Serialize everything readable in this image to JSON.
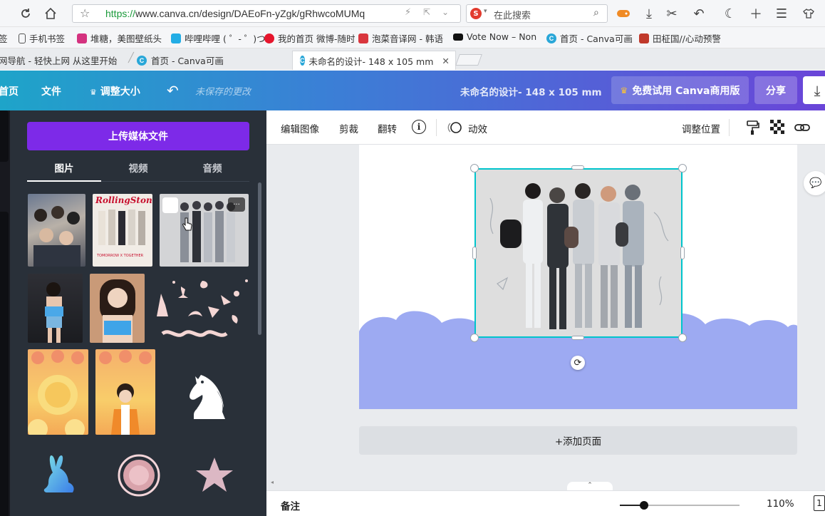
{
  "browser": {
    "url_scheme": "https://",
    "url_rest": "www.canva.cn/design/DAEoFn-yZgk/gRhwcoMUMq",
    "search_placeholder": "在此搜索",
    "search_engine_icon": "S"
  },
  "bookmarks": [
    {
      "label": "签"
    },
    {
      "label": "手机书签"
    },
    {
      "label": "堆糖，美图壁纸头"
    },
    {
      "label": "哔哩哔哩 ( ゜- ゜)つ"
    },
    {
      "label": "我的首页 微博-随时"
    },
    {
      "label": "泡菜音译网 - 韩语"
    },
    {
      "label": "Vote Now – Non"
    },
    {
      "label": "首页 - Canva可画"
    },
    {
      "label": "田柾国//心动预警"
    }
  ],
  "tabs": [
    {
      "label": "网导航 - 轻快上网 从这里开始"
    },
    {
      "label": "首页 - Canva可画"
    },
    {
      "label": "未命名的设计- 148 x 105 mm"
    }
  ],
  "header": {
    "home": "首页",
    "file": "文件",
    "resize": "调整大小",
    "unsaved": "未保存的更改",
    "title": "未命名的设计- 148 x 105 mm",
    "trial": "免费试用 Canva商用版",
    "share": "分享"
  },
  "panel": {
    "upload": "上传媒体文件",
    "tabs": [
      "图片",
      "视频",
      "音频"
    ],
    "thumb_text": {
      "magazine": "RollingStone",
      "magazine_sub": "TOMORROW X TOGETHER",
      "more": "···"
    }
  },
  "toolbar": {
    "edit_image": "编辑图像",
    "crop": "剪裁",
    "flip": "翻转",
    "info": "i",
    "animate": "动效",
    "position": "调整位置"
  },
  "editor": {
    "add_page": "+添加页面",
    "notes": "备注",
    "zoom": "110%",
    "page_count": "1"
  },
  "colors": {
    "accent_purple": "#7d2ae8",
    "panel_bg": "#293039",
    "wave": "#9daaf2",
    "selection": "#00c4cc"
  }
}
